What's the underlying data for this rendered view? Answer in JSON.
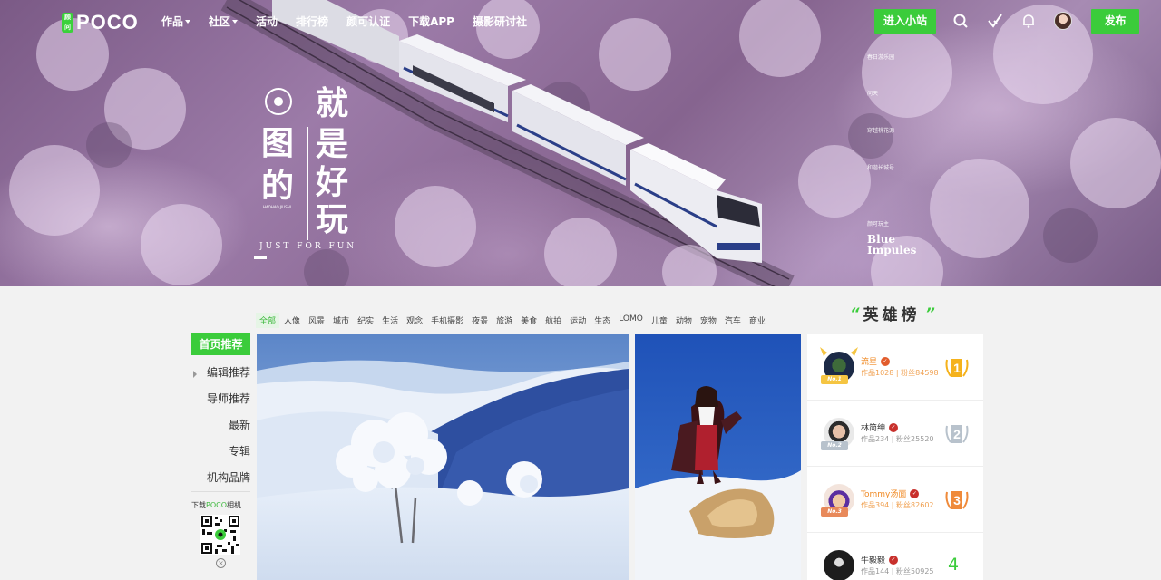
{
  "nav": {
    "logo_badge": "顾问",
    "logo_text": "POCO",
    "items": [
      {
        "label": "作品",
        "dropdown": true
      },
      {
        "label": "社区",
        "dropdown": true
      },
      {
        "label": "活动",
        "dropdown": false
      },
      {
        "label": "排行榜",
        "dropdown": false
      },
      {
        "label": "颜可认证",
        "dropdown": false
      },
      {
        "label": "下载APP",
        "dropdown": false
      },
      {
        "label": "摄影研讨社",
        "dropdown": false
      }
    ],
    "enter_button": "进入小站",
    "publish_button": "发布",
    "icons": [
      "search-icon",
      "check-icon",
      "bell-icon"
    ],
    "accent": "#3bcc3b"
  },
  "hero": {
    "title_chars": [
      "就",
      "是",
      "好",
      "玩",
      "图",
      "的"
    ],
    "tagline_en": "JUST FOR FUN",
    "small_text": "HAOHAO JIUSHI",
    "slides": [
      "春日游乐园",
      "问天",
      "穿越桃花源",
      "和谐长城号",
      "颜可玩主"
    ],
    "active_slide": {
      "line1": "Blue",
      "line2": "Impules"
    }
  },
  "categories": {
    "items": [
      "全部",
      "人像",
      "风景",
      "城市",
      "纪实",
      "生活",
      "观念",
      "手机摄影",
      "夜景",
      "旅游",
      "美食",
      "航拍",
      "运动",
      "生态",
      "LOMO",
      "儿童",
      "动物",
      "宠物",
      "汽车",
      "商业"
    ],
    "active_index": 0
  },
  "leftnav": {
    "head": "首页推荐",
    "items": [
      "编辑推荐",
      "导师推荐",
      "最新",
      "专辑",
      "机构品牌"
    ],
    "download_prefix": "下载",
    "download_brand": "POCO",
    "download_suffix": "相机",
    "close": "×"
  },
  "board": {
    "title": "英雄榜",
    "rows": [
      {
        "name": "流星",
        "stats": "作品1028 | 粉丝84598",
        "badge": "No.1",
        "rank": "1",
        "name_color": "#f08a24"
      },
      {
        "name": "林简绅",
        "stats": "作品234 | 粉丝25520",
        "badge": "No.2",
        "rank": "2",
        "name_color": "#333333"
      },
      {
        "name": "Tommy汤面",
        "stats": "作品394 | 粉丝82602",
        "badge": "No.3",
        "rank": "3",
        "name_color": "#f08a24"
      },
      {
        "name": "牛毅毅",
        "stats": "作品144 | 粉丝50925",
        "badge": "",
        "rank": "4",
        "name_color": "#333333"
      }
    ]
  }
}
